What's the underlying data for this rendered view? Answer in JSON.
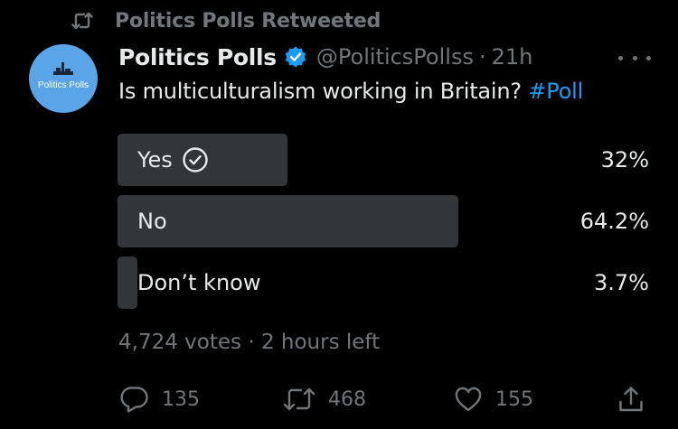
{
  "retweet_context": {
    "text": "Politics Polls Retweeted",
    "icon": "retweet-icon"
  },
  "author": {
    "avatar_text": "Politics Polls",
    "display_name": "Politics Polls",
    "verified": true,
    "handle": "@PoliticsPollss",
    "separator": "·",
    "time": "21h"
  },
  "tweet": {
    "text": "Is multiculturalism working in Britain?",
    "hashtag": "#Poll"
  },
  "poll": {
    "options": [
      {
        "label": "Yes",
        "percent_text": "32%",
        "percent": 32,
        "selected": true
      },
      {
        "label": "No",
        "percent_text": "64.2%",
        "percent": 64.2,
        "selected": false
      },
      {
        "label": "Don’t know",
        "percent_text": "3.7%",
        "percent": 3.7,
        "selected": false
      }
    ],
    "votes": "4,724 votes",
    "separator": "·",
    "time_left": "2 hours left"
  },
  "actions": {
    "reply_count": "135",
    "retweet_count": "468",
    "like_count": "155"
  },
  "colors": {
    "background": "#000000",
    "text_primary": "#e7e9ea",
    "text_secondary": "#71767b",
    "accent": "#1d9bf0",
    "poll_bar": "#333639",
    "avatar_bg": "#5aa4e8"
  }
}
